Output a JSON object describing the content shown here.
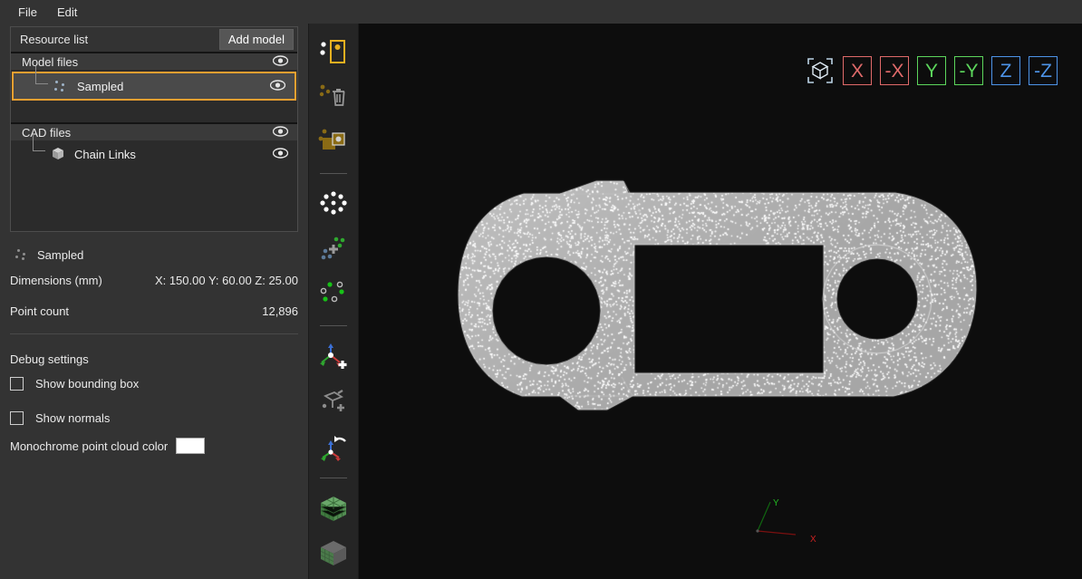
{
  "menubar": {
    "items": [
      {
        "label": "File"
      },
      {
        "label": "Edit"
      }
    ]
  },
  "sidebar": {
    "resource_list": {
      "title": "Resource list",
      "add_model_label": "Add model",
      "groups": [
        {
          "name": "Model files",
          "icon": "eye-icon",
          "items": [
            {
              "label": "Sampled",
              "icon": "point-cloud-icon",
              "selected": true,
              "visibility_icon": "eye-icon"
            }
          ]
        },
        {
          "name": "CAD files",
          "icon": "eye-icon",
          "items": [
            {
              "label": "Chain Links",
              "icon": "cube-icon",
              "selected": false,
              "visibility_icon": "eye-icon"
            }
          ]
        }
      ]
    },
    "properties": {
      "title": "Sampled",
      "rows": [
        {
          "key": "Dimensions (mm)",
          "value": "X: 150.00 Y: 60.00 Z: 25.00"
        },
        {
          "key": "Point count",
          "value": "12,896"
        }
      ]
    },
    "debug": {
      "title": "Debug settings",
      "checkboxes": [
        {
          "label": "Show bounding box",
          "checked": false
        },
        {
          "label": "Show normals",
          "checked": false
        }
      ],
      "color_label": "Monochrome point cloud color",
      "color_value": "#ffffff"
    }
  },
  "toolbar": {
    "tools": [
      {
        "name": "rectangle-select-icon",
        "active": true
      },
      {
        "name": "delete-points-icon",
        "active": false
      },
      {
        "name": "crop-box-icon",
        "active": false
      },
      {
        "name": "ring-select-icon",
        "active": false
      },
      {
        "name": "add-points-icon",
        "active": false
      },
      {
        "name": "toggle-points-icon",
        "active": false
      },
      {
        "name": "add-origin-icon",
        "active": false
      },
      {
        "name": "add-plane-icon",
        "active": false
      },
      {
        "name": "rotate-axis-icon",
        "active": false
      },
      {
        "name": "voxel-grid-icon",
        "active": false
      },
      {
        "name": "mesh-cube-icon",
        "active": false
      }
    ]
  },
  "viewport": {
    "axis_buttons": [
      {
        "label": "",
        "name": "iso-view-button",
        "color": "#bcd4e6"
      },
      {
        "label": "X",
        "name": "x-view-button",
        "color": "#e06a6a"
      },
      {
        "label": "-X",
        "name": "neg-x-view-button",
        "color": "#e06a6a"
      },
      {
        "label": "Y",
        "name": "y-view-button",
        "color": "#5cd65c"
      },
      {
        "label": "-Y",
        "name": "neg-y-view-button",
        "color": "#5cd65c"
      },
      {
        "label": "Z",
        "name": "z-view-button",
        "color": "#4d94e8"
      },
      {
        "label": "-Z",
        "name": "neg-z-view-button",
        "color": "#4d94e8"
      }
    ],
    "gizmo": {
      "x_label": "X",
      "y_label": "Y"
    },
    "background_color": "#0d0d0d",
    "point_color": "#ffffff",
    "model_name": "Sampled"
  },
  "colors": {
    "accent_orange": "#f0a030",
    "axis_red": "#e06a6a",
    "axis_green": "#5cd65c",
    "axis_blue": "#4d94e8",
    "panel_bg": "#333333",
    "list_bg": "#2b2b2b"
  }
}
